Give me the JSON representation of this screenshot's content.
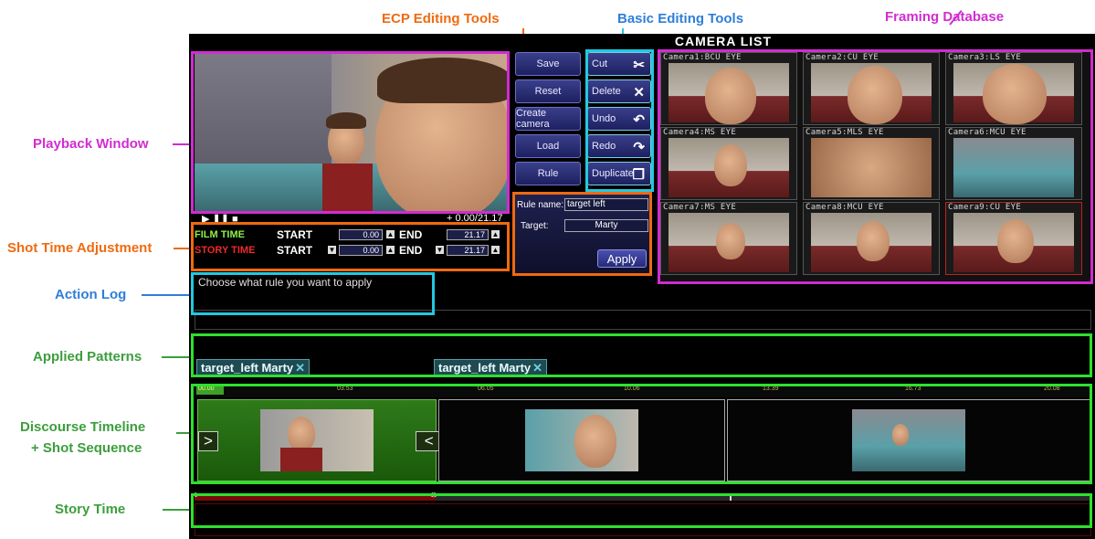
{
  "annotations": {
    "ecp_tools": "ECP Editing Tools",
    "basic_tools": "Basic Editing Tools",
    "framing_db": "Framing Database",
    "playback": "Playback Window",
    "shot_time": "Shot Time Adjustment",
    "action_log": "Action Log",
    "applied_patterns": "Applied Patterns",
    "discourse_line1": "Discourse Timeline",
    "discourse_line2": "+ Shot Sequence",
    "story_time": "Story Time"
  },
  "camera_list_title": "CAMERA LIST",
  "playback": {
    "controls": "▶ ❚❚ ■",
    "time": "+ 0.00/21.17"
  },
  "shot_time": {
    "film_label": "FILM TIME",
    "story_label": "STORY TIME",
    "start_label": "START",
    "end_label": "END",
    "film_start": "0.00",
    "film_end": "21.17",
    "story_start": "0.00",
    "story_end": "21.17"
  },
  "ecp_buttons": [
    "Save",
    "Reset",
    "Create camera",
    "Load",
    "Rule"
  ],
  "basic_buttons": [
    {
      "label": "Cut",
      "icon": "scissors-icon",
      "glyph": "✂"
    },
    {
      "label": "Delete",
      "icon": "delete-x-icon",
      "glyph": "✕"
    },
    {
      "label": "Undo",
      "icon": "undo-arrow-icon",
      "glyph": "↶"
    },
    {
      "label": "Redo",
      "icon": "redo-arrow-icon",
      "glyph": "↷"
    },
    {
      "label": "Duplicate",
      "icon": "duplicate-icon",
      "glyph": "❐"
    }
  ],
  "rule_panel": {
    "rule_name_label": "Rule name:",
    "rule_name_value": "target left",
    "target_label": "Target:",
    "target_value": "Marty",
    "apply_label": "Apply"
  },
  "cameras": [
    {
      "label": "Camera1:BCU EYE"
    },
    {
      "label": "Camera2:CU EYE"
    },
    {
      "label": "Camera3:LS EYE"
    },
    {
      "label": "Camera4:MS EYE"
    },
    {
      "label": "Camera5:MLS EYE"
    },
    {
      "label": "Camera6:MCU EYE"
    },
    {
      "label": "Camera7:MS EYE"
    },
    {
      "label": "Camera8:MCU EYE"
    },
    {
      "label": "Camera9:CU EYE"
    }
  ],
  "action_log_text": "Choose what rule you want to apply",
  "applied_patterns": [
    {
      "label": "target_left Marty",
      "close": "✕"
    },
    {
      "label": "target_left Marty",
      "close": "✕"
    }
  ],
  "timeline_ticks": [
    "00.00",
    "03.53",
    "06.05",
    "10.06",
    "13.39",
    "16.73",
    "20.08"
  ],
  "shots": {
    "nav_right": ">",
    "nav_both": "< >"
  },
  "story_markers": {
    "start": ">",
    "mid": "<>"
  },
  "colors": {
    "magenta": "#d12cd1",
    "orange": "#ef6a10",
    "blue": "#2f7ed8",
    "green": "#3c9e3c",
    "cyan_box": "#22c8e0",
    "green_box": "#2ee02e"
  }
}
